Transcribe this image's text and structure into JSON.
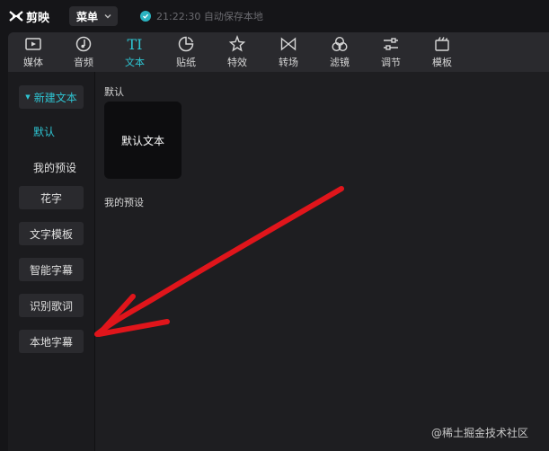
{
  "app": {
    "logo_text": "剪映"
  },
  "topbar": {
    "menu_label": "菜单",
    "save_status": "21:22:30 自动保存本地"
  },
  "toolbar": {
    "tools": [
      {
        "label": "媒体",
        "icon": "media-icon"
      },
      {
        "label": "音频",
        "icon": "audio-icon"
      },
      {
        "label": "文本",
        "icon": "text-icon",
        "active": true
      },
      {
        "label": "贴纸",
        "icon": "sticker-icon"
      },
      {
        "label": "特效",
        "icon": "effects-icon"
      },
      {
        "label": "转场",
        "icon": "transition-icon"
      },
      {
        "label": "滤镜",
        "icon": "filter-icon"
      },
      {
        "label": "调节",
        "icon": "adjust-icon"
      },
      {
        "label": "模板",
        "icon": "template-icon"
      }
    ]
  },
  "sidebar": {
    "new_text": "新建文本",
    "sub_items": [
      "默认",
      "我的预设"
    ],
    "items": [
      "花字",
      "文字模板",
      "智能字幕",
      "识别歌词",
      "本地字幕"
    ]
  },
  "main": {
    "default_section": "默认",
    "default_card": "默认文本",
    "my_presets_section": "我的预设"
  },
  "watermark": "@稀土掘金技术社区",
  "colors": {
    "accent": "#2ec5d3",
    "annotation_arrow": "#e0151b"
  }
}
